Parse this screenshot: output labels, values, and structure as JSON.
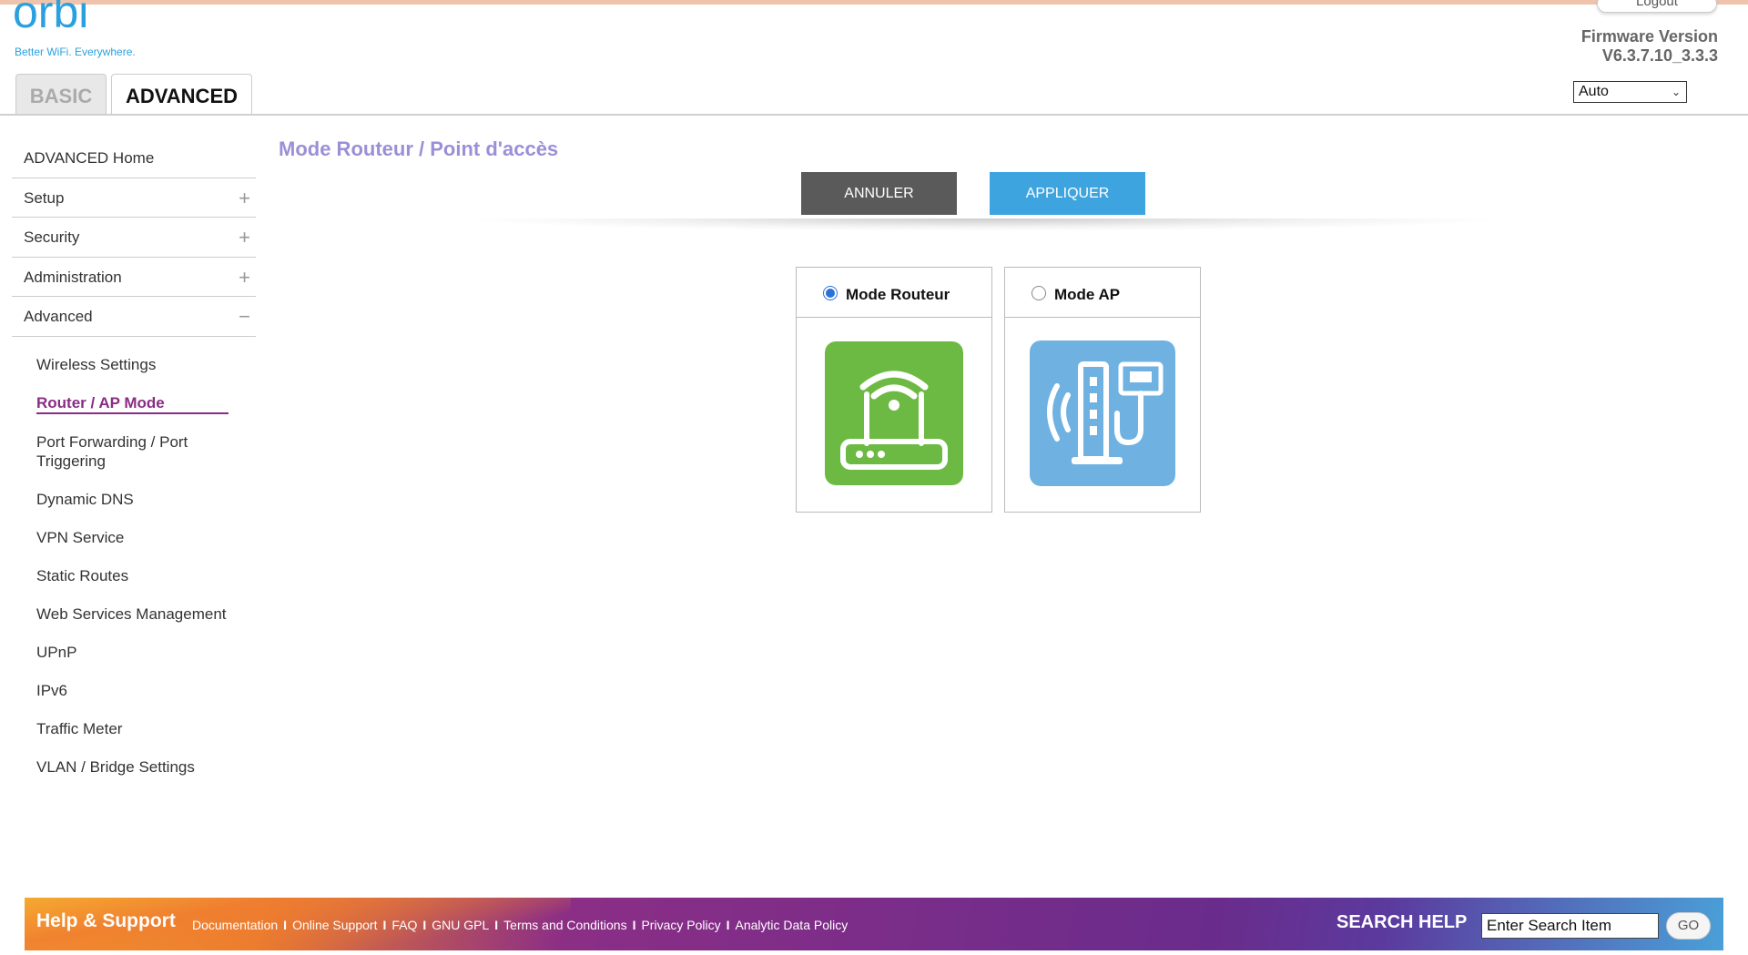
{
  "brand": {
    "logo_text": "orbi",
    "tagline": "Better WiFi. Everywhere."
  },
  "header": {
    "logout_label": "Logout",
    "firmware_title": "Firmware Version",
    "firmware_value": "V6.3.7.10_3.3.3",
    "language_selected": "Auto",
    "tabs": [
      {
        "label": "BASIC",
        "active": false
      },
      {
        "label": "ADVANCED",
        "active": true
      }
    ]
  },
  "sidebar": {
    "items": [
      {
        "label": "ADVANCED Home",
        "symbol": ""
      },
      {
        "label": "Setup",
        "symbol": "+"
      },
      {
        "label": "Security",
        "symbol": "+"
      },
      {
        "label": "Administration",
        "symbol": "+"
      },
      {
        "label": "Advanced",
        "symbol": "−"
      }
    ],
    "sub_items": [
      {
        "label": "Wireless Settings"
      },
      {
        "label": "Router / AP Mode"
      },
      {
        "label": "Port Forwarding / Port Triggering"
      },
      {
        "label": "Dynamic DNS"
      },
      {
        "label": "VPN Service"
      },
      {
        "label": "Static Routes"
      },
      {
        "label": "Web Services Management"
      },
      {
        "label": "UPnP"
      },
      {
        "label": "IPv6"
      },
      {
        "label": "Traffic Meter"
      },
      {
        "label": "VLAN / Bridge Settings"
      }
    ]
  },
  "main": {
    "title": "Mode Routeur / Point d'accès",
    "cancel_label": "ANNULER",
    "apply_label": "APPLIQUER",
    "modes": [
      {
        "label": "Mode Routeur",
        "selected": true
      },
      {
        "label": "Mode AP",
        "selected": false
      }
    ]
  },
  "footer": {
    "title": "Help & Support",
    "links": [
      "Documentation",
      "Online Support",
      "FAQ",
      "GNU GPL",
      "Terms and Conditions",
      "Privacy Policy",
      "Analytic Data Policy"
    ],
    "separator": "I",
    "search_label": "SEARCH HELP",
    "search_placeholder": "Enter Search Item",
    "go_label": "GO"
  },
  "colors": {
    "accent_blue": "#3da4e0",
    "title_purple": "#9b8fd8",
    "active_nav": "#8a2c86",
    "router_green": "#6cba43",
    "ap_blue": "#6fb2e2"
  },
  "icons": [
    "router-icon",
    "access-point-icon",
    "plus-icon",
    "minus-icon",
    "chevron-down-icon"
  ]
}
